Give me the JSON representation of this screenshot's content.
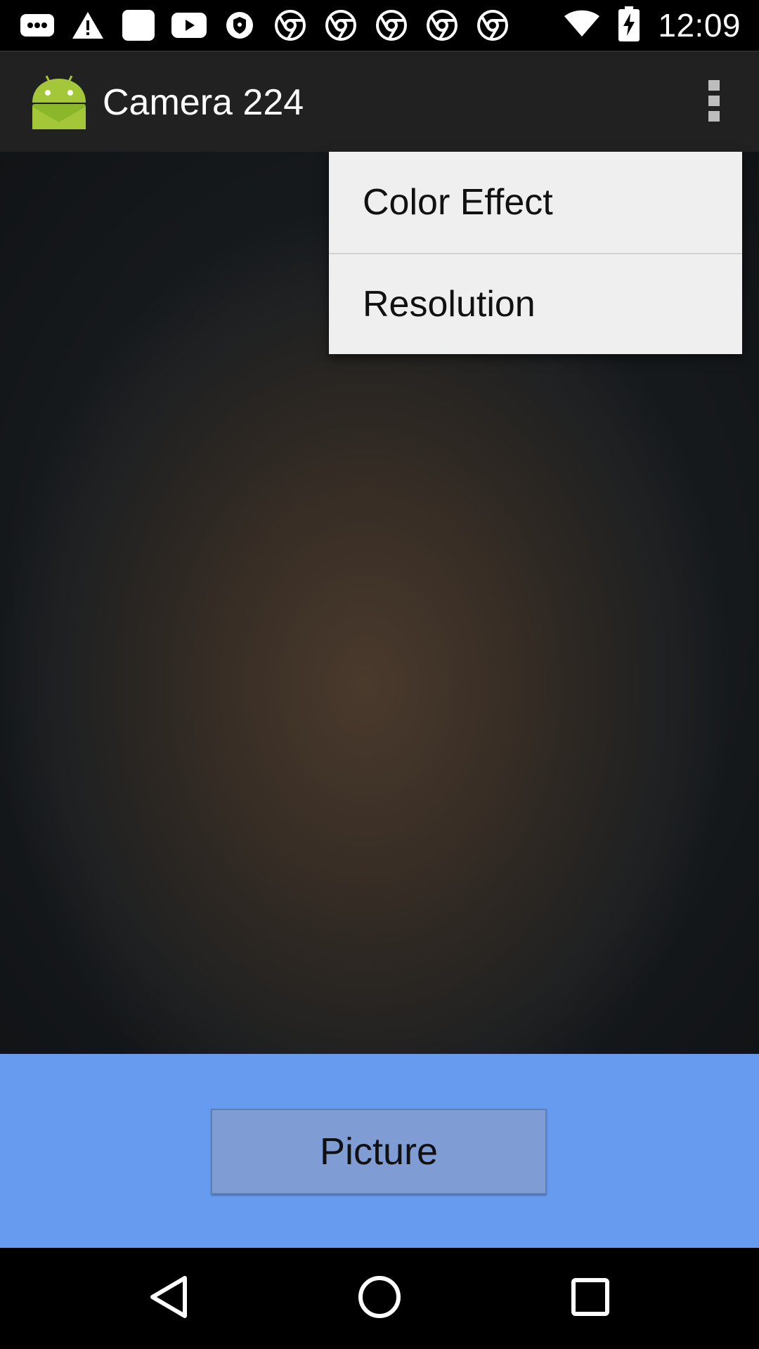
{
  "status_bar": {
    "time": "12:09",
    "notification_icons": [
      "more-notifications-icon",
      "warning-icon",
      "blank-notification-icon",
      "youtube-icon",
      "vpn-shield-icon",
      "chrome-icon",
      "chrome-icon",
      "chrome-icon",
      "chrome-icon",
      "chrome-icon"
    ],
    "system_icons": [
      "wifi-icon",
      "battery-charging-icon"
    ]
  },
  "action_bar": {
    "title": "Camera 224",
    "app_icon": "android-robot-icon",
    "overflow_icon": "more-vert-icon"
  },
  "overflow_menu": {
    "items": [
      {
        "label": "Color Effect"
      },
      {
        "label": "Resolution"
      }
    ]
  },
  "bottom_panel": {
    "picture_button_label": "Picture",
    "background_color": "#679bf0"
  },
  "nav_bar": {
    "icons": [
      "back-icon",
      "home-icon",
      "recents-icon"
    ]
  }
}
